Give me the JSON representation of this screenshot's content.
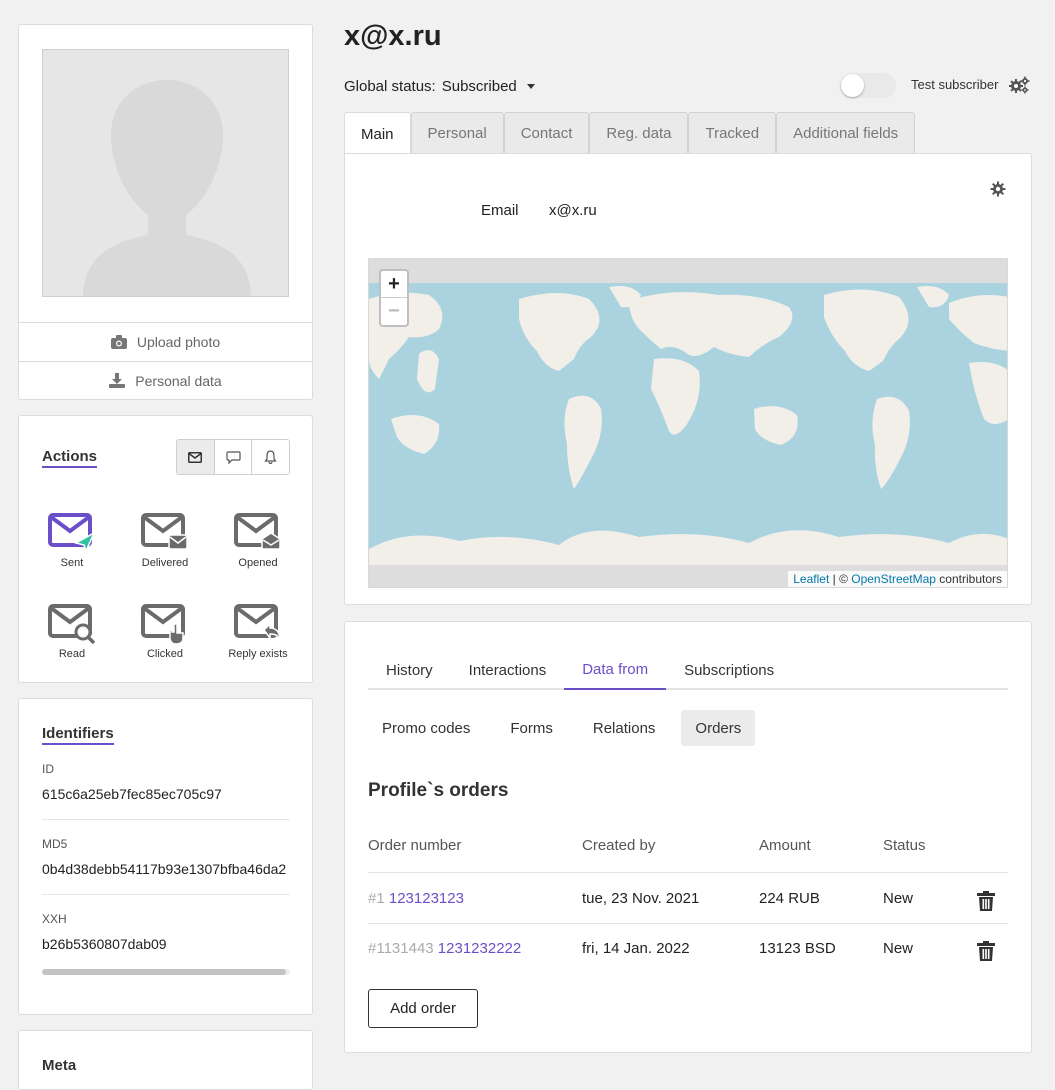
{
  "profile": {
    "title": "x@x.ru",
    "global_status_label": "Global status:",
    "global_status_value": "Subscribed",
    "test_subscriber_label": "Test subscriber",
    "test_subscriber_on": false
  },
  "photo_card": {
    "upload_label": "Upload photo",
    "personal_label": "Personal data"
  },
  "actions": {
    "title": "Actions",
    "channels": [
      "email-icon",
      "chat-icon",
      "bell-icon"
    ],
    "items": [
      {
        "label": "Sent",
        "icon": "sent-icon",
        "active": true
      },
      {
        "label": "Delivered",
        "icon": "delivered-icon",
        "active": false
      },
      {
        "label": "Opened",
        "icon": "opened-icon",
        "active": false
      },
      {
        "label": "Read",
        "icon": "read-icon",
        "active": false
      },
      {
        "label": "Clicked",
        "icon": "clicked-icon",
        "active": false
      },
      {
        "label": "Reply exists",
        "icon": "reply-icon",
        "active": false
      }
    ]
  },
  "identifiers": {
    "title": "Identifiers",
    "items": [
      {
        "label": "ID",
        "value": "615c6a25eb7fec85ec705c97"
      },
      {
        "label": "MD5",
        "value": "0b4d38debb54117b93e1307bfba46da2"
      },
      {
        "label": "XXH",
        "value": "b26b5360807dab09"
      }
    ]
  },
  "meta": {
    "title": "Meta"
  },
  "tabs": [
    {
      "label": "Main",
      "active": true
    },
    {
      "label": "Personal",
      "active": false
    },
    {
      "label": "Contact",
      "active": false
    },
    {
      "label": "Reg. data",
      "active": false
    },
    {
      "label": "Tracked",
      "active": false
    },
    {
      "label": "Additional fields",
      "active": false
    }
  ],
  "main_panel": {
    "email_label": "Email",
    "email_value": "x@x.ru",
    "map": {
      "zoom_in": "+",
      "zoom_out": "−",
      "attr_leaflet": "Leaflet",
      "attr_sep": " | © ",
      "attr_osm": "OpenStreetMap",
      "attr_contrib": " contributors"
    }
  },
  "data_panel": {
    "subtabs": [
      {
        "label": "History",
        "active": false
      },
      {
        "label": "Interactions",
        "active": false
      },
      {
        "label": "Data from",
        "active": true
      },
      {
        "label": "Subscriptions",
        "active": false
      }
    ],
    "pills": [
      {
        "label": "Promo codes",
        "active": false
      },
      {
        "label": "Forms",
        "active": false
      },
      {
        "label": "Relations",
        "active": false
      },
      {
        "label": "Orders",
        "active": true
      }
    ],
    "orders_title": "Profile`s orders",
    "columns": [
      "Order number",
      "Created by",
      "Amount",
      "Status"
    ],
    "rows": [
      {
        "prefix": "#1",
        "number": "123123123",
        "created": "tue, 23 Nov. 2021",
        "amount": "224 RUB",
        "status": "New"
      },
      {
        "prefix": "#1131443",
        "number": "1231232222",
        "created": "fri, 14 Jan. 2022",
        "amount": "13123 BSD",
        "status": "New"
      }
    ],
    "add_order_label": "Add order"
  },
  "colors": {
    "accent": "#6b4fc8",
    "sent_accent": "#2ec4a0",
    "map_water": "#aad3df",
    "map_land": "#f2efe9"
  }
}
